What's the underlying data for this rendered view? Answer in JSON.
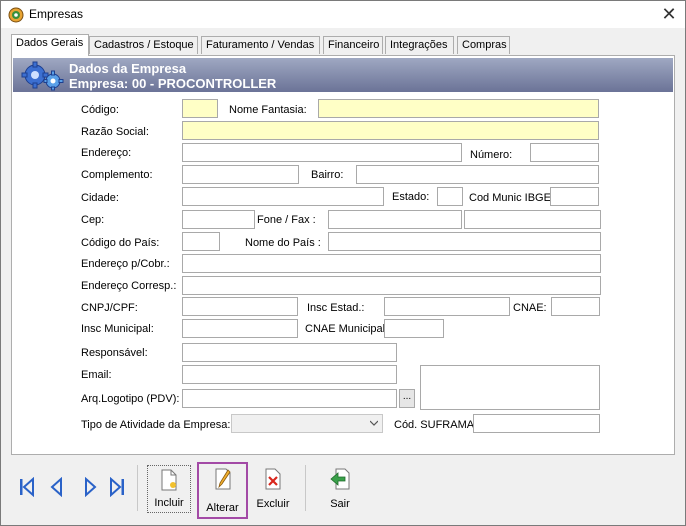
{
  "window": {
    "title": "Empresas",
    "close_symbol": "✕"
  },
  "tabs": [
    {
      "label": "Dados Gerais",
      "active": true
    },
    {
      "label": "Cadastros / Estoque"
    },
    {
      "label": "Faturamento / Vendas"
    },
    {
      "label": "Financeiro"
    },
    {
      "label": "Integrações"
    },
    {
      "label": "Compras"
    }
  ],
  "banner": {
    "title": "Dados da Empresa",
    "subtitle": "Empresa: 00 - PROCONTROLLER"
  },
  "labels": {
    "codigo": "Código:",
    "nome_fantasia": "Nome Fantasia:",
    "razao_social": "Razão Social:",
    "endereco": "Endereço:",
    "numero": "Número:",
    "complemento": "Complemento:",
    "bairro": "Bairro:",
    "cidade": "Cidade:",
    "estado": "Estado:",
    "cod_munic_ibge": "Cod Munic IBGE:",
    "cep": "Cep:",
    "fone_fax": "Fone / Fax :",
    "codigo_pais": "Código do País:",
    "nome_pais": "Nome do País :",
    "endereco_cobr": "Endereço p/Cobr.:",
    "endereco_corresp": "Endereço Corresp.:",
    "cnpj_cpf": "CNPJ/CPF:",
    "insc_estad": "Insc Estad.:",
    "cnae": "CNAE:",
    "insc_municipal": "Insc Municipal:",
    "cnae_municipal": "CNAE Municipal:",
    "responsavel": "Responsável:",
    "email": "Email:",
    "arq_logotipo": "Arq.Logotipo (PDV):",
    "tipo_atividade": "Tipo de Atividade da Empresa:",
    "cod_suframa": "Cód. SUFRAMA:"
  },
  "fields": {
    "codigo": "",
    "nome_fantasia": "",
    "razao_social": "",
    "endereco": "",
    "numero": "",
    "complemento": "",
    "bairro": "",
    "cidade": "",
    "estado": "",
    "cod_munic_ibge": "",
    "cep": "",
    "fone": "",
    "fax": "",
    "codigo_pais": "",
    "nome_pais": "",
    "endereco_cobr": "",
    "endereco_corresp": "",
    "cnpj_cpf": "",
    "insc_estad": "",
    "cnae": "",
    "insc_municipal": "",
    "cnae_municipal": "",
    "responsavel": "",
    "email": "",
    "arq_logotipo": "",
    "tipo_atividade": "",
    "cod_suframa": ""
  },
  "browse_button": "...",
  "toolbar": {
    "incluir": "Incluir",
    "alterar": "Alterar",
    "excluir": "Excluir",
    "sair": "Sair"
  },
  "icons": {
    "app": "app-globe-icon",
    "banner": "gears-icon",
    "first": "first-record-icon",
    "prev": "previous-record-icon",
    "next": "next-record-icon",
    "last": "last-record-icon"
  },
  "colors": {
    "required_field": "#ffffc6",
    "banner": "#7b83a6",
    "highlight": "#a34aa6",
    "nav_arrows": "#2a62c8"
  }
}
